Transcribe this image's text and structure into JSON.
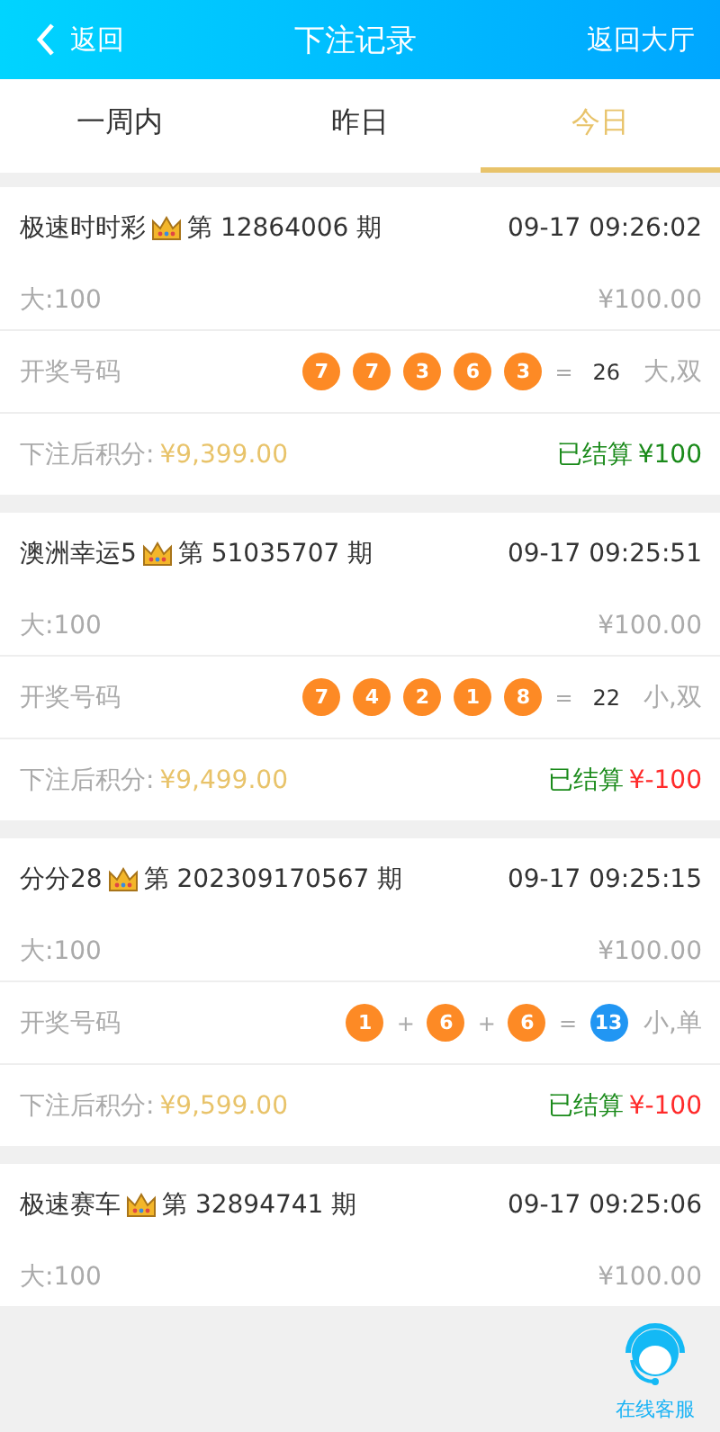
{
  "header": {
    "back": "返回",
    "title": "下注记录",
    "lobby": "返回大厅"
  },
  "tabs": [
    {
      "label": "一周内",
      "selected": false
    },
    {
      "label": "昨日",
      "selected": false
    },
    {
      "label": "今日",
      "selected": true
    }
  ],
  "records": [
    {
      "game": "极速时时彩",
      "period": "第 12864006 期",
      "time": "09-17 09:26:02",
      "bet": "大:100",
      "amount": "¥100.00",
      "draw_label": "开奖号码",
      "draw": [
        {
          "kind": "ball",
          "text": "7",
          "color": "#fd8a25"
        },
        {
          "kind": "ball",
          "text": "7",
          "color": "#fd8a25"
        },
        {
          "kind": "ball",
          "text": "3",
          "color": "#fd8a25"
        },
        {
          "kind": "ball",
          "text": "6",
          "color": "#fd8a25"
        },
        {
          "kind": "ball",
          "text": "3",
          "color": "#fd8a25"
        },
        {
          "kind": "op",
          "text": "="
        },
        {
          "kind": "sum",
          "text": "26"
        }
      ],
      "result": "大,双",
      "balance_label": "下注后积分:",
      "balance": "¥9,399.00",
      "status": "已结算",
      "payout": "¥100",
      "color": "#1a8a1a"
    },
    {
      "game": "澳洲幸运5",
      "period": "第 51035707 期",
      "time": "09-17 09:25:51",
      "bet": "大:100",
      "amount": "¥100.00",
      "draw_label": "开奖号码",
      "draw": [
        {
          "kind": "ball",
          "text": "7",
          "color": "#fd8a25"
        },
        {
          "kind": "ball",
          "text": "4",
          "color": "#fd8a25"
        },
        {
          "kind": "ball",
          "text": "2",
          "color": "#fd8a25"
        },
        {
          "kind": "ball",
          "text": "1",
          "color": "#fd8a25"
        },
        {
          "kind": "ball",
          "text": "8",
          "color": "#fd8a25"
        },
        {
          "kind": "op",
          "text": "="
        },
        {
          "kind": "sum",
          "text": "22"
        }
      ],
      "result": "小,双",
      "balance_label": "下注后积分:",
      "balance": "¥9,499.00",
      "status": "已结算",
      "payout": "¥-100",
      "color": "#ff2a2a"
    },
    {
      "game": "分分28",
      "period": "第 202309170567 期",
      "time": "09-17 09:25:15",
      "bet": "大:100",
      "amount": "¥100.00",
      "draw_label": "开奖号码",
      "draw": [
        {
          "kind": "ball",
          "text": "1",
          "color": "#fd8a25"
        },
        {
          "kind": "op",
          "text": "+"
        },
        {
          "kind": "ball",
          "text": "6",
          "color": "#fd8a25"
        },
        {
          "kind": "op",
          "text": "+"
        },
        {
          "kind": "ball",
          "text": "6",
          "color": "#fd8a25"
        },
        {
          "kind": "op",
          "text": "="
        },
        {
          "kind": "ball",
          "text": "13",
          "color": "#2196f3"
        }
      ],
      "result": "小,单",
      "balance_label": "下注后积分:",
      "balance": "¥9,599.00",
      "status": "已结算",
      "payout": "¥-100",
      "color": "#ff2a2a"
    },
    {
      "game": "极速赛车",
      "period": "第 32894741 期",
      "time": "09-17 09:25:06",
      "bet": "大:100",
      "amount": "¥100.00"
    }
  ],
  "support": {
    "label": "在线客服"
  }
}
